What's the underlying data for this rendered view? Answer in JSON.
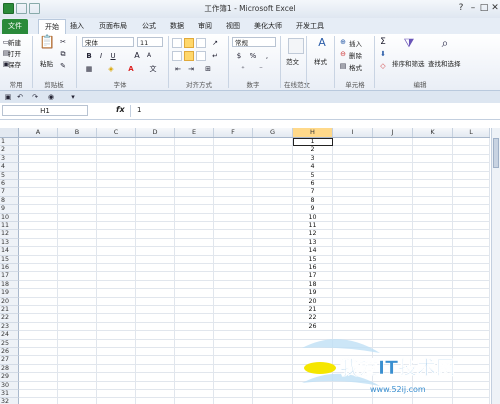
{
  "window": {
    "title": "工作簿1 - Microsoft Excel",
    "minimize": "–",
    "maximize": "□",
    "close": "✕"
  },
  "tabs": [
    {
      "label": "文件"
    },
    {
      "label": "开始"
    },
    {
      "label": "插入"
    },
    {
      "label": "页面布局"
    },
    {
      "label": "公式"
    },
    {
      "label": "数据"
    },
    {
      "label": "审阅"
    },
    {
      "label": "视图"
    },
    {
      "label": "美化大师"
    },
    {
      "label": "开发工具"
    }
  ],
  "ribbon": {
    "group_labels": {
      "quick": "常用",
      "clipboard": "剪贴板",
      "font": "字体",
      "alignment": "对齐方式",
      "number": "数字",
      "style_name": "在线范文",
      "cells": "单元格",
      "editing": "编辑"
    },
    "quick": {
      "new": "新建",
      "open": "打开",
      "save": "保存"
    },
    "clipboard": {
      "paste": "粘贴"
    },
    "font": {
      "name": "宋体",
      "size": "11",
      "bold": "B",
      "italic": "I",
      "underline": "U",
      "grow": "A",
      "shrink": "A",
      "color": "A",
      "wen": "文"
    },
    "number": {
      "format": "常规",
      "currency": "$",
      "percent": "%",
      "comma": ","
    },
    "styles": {
      "label": "样式",
      "fanwen": "范文"
    },
    "cells": {
      "insert": "插入",
      "delete": "删除",
      "format": "格式"
    },
    "editing": {
      "sum": "Σ",
      "sort_filter": "排序和筛选",
      "find_select": "查找和选择"
    }
  },
  "formula_bar": {
    "name_box": "H1",
    "fx": "fx",
    "value": "1"
  },
  "columns": [
    "A",
    "B",
    "C",
    "D",
    "E",
    "F",
    "G",
    "H",
    "I",
    "J",
    "K",
    "L"
  ],
  "selected_column": "H",
  "rows": [
    {
      "n": "1",
      "h": "1"
    },
    {
      "n": "2",
      "h": "2"
    },
    {
      "n": "3",
      "h": "3"
    },
    {
      "n": "4",
      "h": "4"
    },
    {
      "n": "5",
      "h": "5"
    },
    {
      "n": "6",
      "h": "6"
    },
    {
      "n": "7",
      "h": "7"
    },
    {
      "n": "8",
      "h": "8"
    },
    {
      "n": "9",
      "h": "9"
    },
    {
      "n": "10",
      "h": "10"
    },
    {
      "n": "11",
      "h": "11"
    },
    {
      "n": "12",
      "h": "12"
    },
    {
      "n": "13",
      "h": "13"
    },
    {
      "n": "14",
      "h": "14"
    },
    {
      "n": "15",
      "h": "15"
    },
    {
      "n": "16",
      "h": "16"
    },
    {
      "n": "17",
      "h": "17"
    },
    {
      "n": "18",
      "h": "18"
    },
    {
      "n": "19",
      "h": "19"
    },
    {
      "n": "20",
      "h": "20"
    },
    {
      "n": "21",
      "h": "21"
    },
    {
      "n": "22",
      "h": "22"
    },
    {
      "n": "23",
      "h": "26"
    },
    {
      "n": "24",
      "h": ""
    },
    {
      "n": "25",
      "h": ""
    },
    {
      "n": "26",
      "h": ""
    },
    {
      "n": "27",
      "h": ""
    },
    {
      "n": "28",
      "h": ""
    },
    {
      "n": "29",
      "h": ""
    },
    {
      "n": "30",
      "h": ""
    },
    {
      "n": "31",
      "h": ""
    },
    {
      "n": "32",
      "h": ""
    }
  ],
  "watermark": {
    "text": "我爱IT技术网",
    "url": "www.52ij.com"
  },
  "colors": {
    "file_tab": "#2a8a3a",
    "selection": "#ffd98a",
    "watermark": "#3a8fd0"
  }
}
